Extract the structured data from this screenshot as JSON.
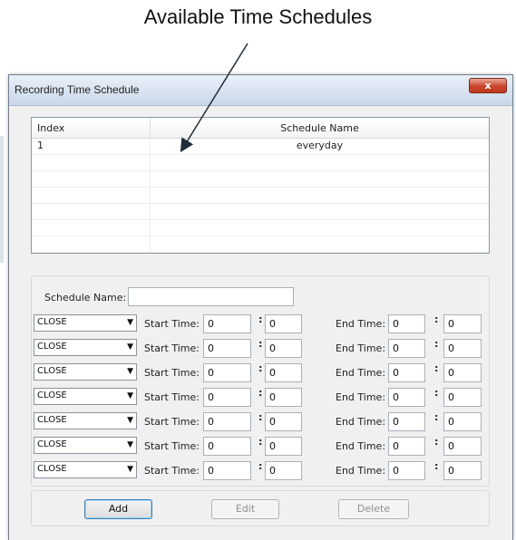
{
  "annotation": {
    "text": "Available Time Schedules"
  },
  "window": {
    "title": "Recording Time Schedule",
    "close_glyph": "x"
  },
  "list": {
    "headers": {
      "index": "Index",
      "name": "Schedule Name"
    },
    "rows": [
      {
        "index": "1",
        "name": "everyday"
      },
      {
        "index": "",
        "name": ""
      },
      {
        "index": "",
        "name": ""
      },
      {
        "index": "",
        "name": ""
      },
      {
        "index": "",
        "name": ""
      },
      {
        "index": "",
        "name": ""
      },
      {
        "index": "",
        "name": ""
      }
    ]
  },
  "form": {
    "schedule_name_label": "Schedule Name:",
    "schedule_name_value": "",
    "start_label": "Start Time:",
    "end_label": "End Time:",
    "colon": ":",
    "rows": [
      {
        "mode": "CLOSE",
        "start_h": "0",
        "start_m": "0",
        "end_h": "0",
        "end_m": "0"
      },
      {
        "mode": "CLOSE",
        "start_h": "0",
        "start_m": "0",
        "end_h": "0",
        "end_m": "0"
      },
      {
        "mode": "CLOSE",
        "start_h": "0",
        "start_m": "0",
        "end_h": "0",
        "end_m": "0"
      },
      {
        "mode": "CLOSE",
        "start_h": "0",
        "start_m": "0",
        "end_h": "0",
        "end_m": "0"
      },
      {
        "mode": "CLOSE",
        "start_h": "0",
        "start_m": "0",
        "end_h": "0",
        "end_m": "0"
      },
      {
        "mode": "CLOSE",
        "start_h": "0",
        "start_m": "0",
        "end_h": "0",
        "end_m": "0"
      },
      {
        "mode": "CLOSE",
        "start_h": "0",
        "start_m": "0",
        "end_h": "0",
        "end_m": "0"
      }
    ]
  },
  "buttons": {
    "add": "Add",
    "edit": "Edit",
    "delete": "Delete"
  },
  "icons": {
    "dropdown": "chevron-down-icon"
  },
  "colors": {
    "title_bg": "#c9d8ea",
    "close_button": "#c8452c",
    "window_bg": "#f0f0f0"
  }
}
